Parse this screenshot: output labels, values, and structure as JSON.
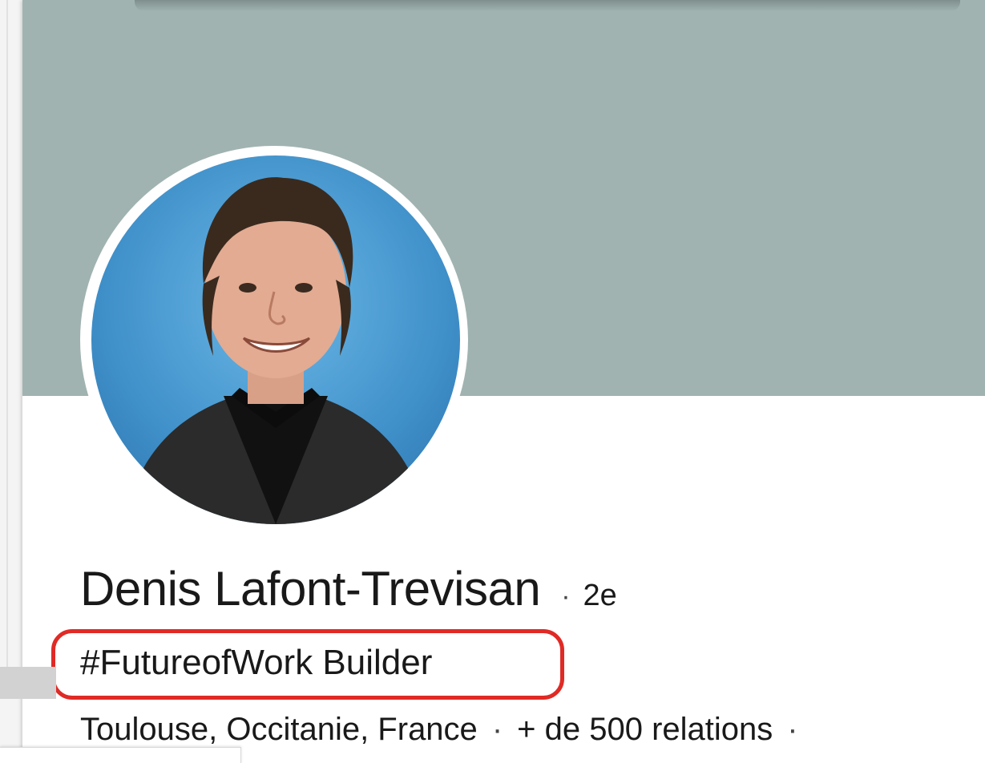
{
  "profile": {
    "name": "Denis Lafont-Trevisan",
    "degree_separator": "·",
    "degree": "2e",
    "headline": "#FutureofWork Builder",
    "location": "Toulouse, Occitanie, France",
    "meta_separator": "·",
    "connections": "+ de 500 relations",
    "trailing_separator": "·"
  },
  "colors": {
    "banner": "#a0b3b1",
    "highlight_outline": "#e02a25",
    "text": "#191919"
  }
}
